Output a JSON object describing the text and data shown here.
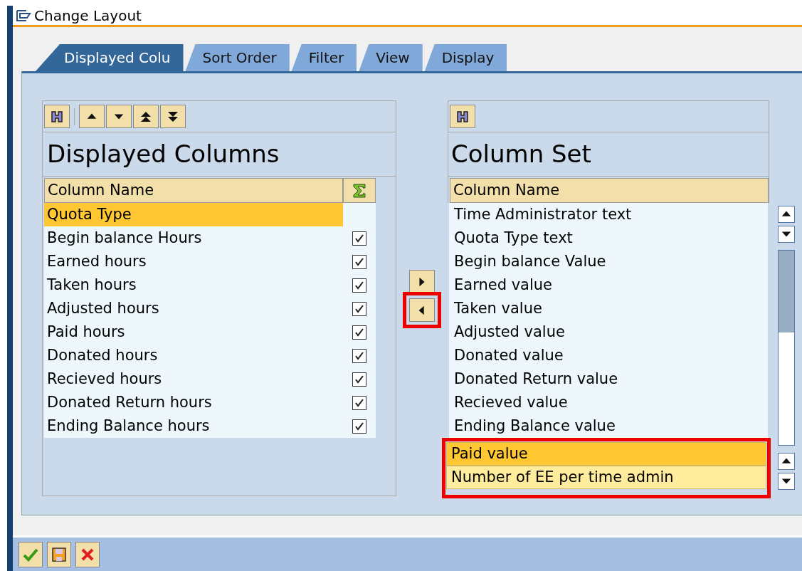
{
  "window": {
    "title": "Change Layout"
  },
  "tabs": [
    {
      "label": "Displayed Colu",
      "selected": true
    },
    {
      "label": "Sort Order",
      "selected": false
    },
    {
      "label": "Filter",
      "selected": false
    },
    {
      "label": "View",
      "selected": false
    },
    {
      "label": "Display",
      "selected": false
    }
  ],
  "displayed_columns": {
    "title": "Displayed Columns",
    "header": "Column Name",
    "items": [
      {
        "name": "Quota Type",
        "selected": true,
        "checked": false
      },
      {
        "name": "Begin balance Hours",
        "selected": false,
        "checked": true
      },
      {
        "name": "Earned hours",
        "selected": false,
        "checked": true
      },
      {
        "name": "Taken hours",
        "selected": false,
        "checked": true
      },
      {
        "name": "Adjusted hours",
        "selected": false,
        "checked": true
      },
      {
        "name": "Paid hours",
        "selected": false,
        "checked": true
      },
      {
        "name": "Donated hours",
        "selected": false,
        "checked": true
      },
      {
        "name": "Recieved hours",
        "selected": false,
        "checked": true
      },
      {
        "name": "Donated Return hours",
        "selected": false,
        "checked": true
      },
      {
        "name": "Ending Balance hours",
        "selected": false,
        "checked": true
      }
    ]
  },
  "transfer_buttons": [
    {
      "kind": "add",
      "highlighted": false
    },
    {
      "kind": "remove",
      "highlighted": true
    }
  ],
  "column_set": {
    "title": "Column Set",
    "header": "Column Name",
    "items": [
      {
        "name": "Time Administrator text",
        "selected": false,
        "current": false,
        "highlighted": false
      },
      {
        "name": "Quota Type text",
        "selected": false,
        "current": false,
        "highlighted": false
      },
      {
        "name": "Begin balance Value",
        "selected": false,
        "current": false,
        "highlighted": false
      },
      {
        "name": "Earned value",
        "selected": false,
        "current": false,
        "highlighted": false
      },
      {
        "name": "Taken value",
        "selected": false,
        "current": false,
        "highlighted": false
      },
      {
        "name": "Adjusted value",
        "selected": false,
        "current": false,
        "highlighted": false
      },
      {
        "name": "Donated value",
        "selected": false,
        "current": false,
        "highlighted": false
      },
      {
        "name": "Donated Return value",
        "selected": false,
        "current": false,
        "highlighted": false
      },
      {
        "name": "Recieved value",
        "selected": false,
        "current": false,
        "highlighted": false
      },
      {
        "name": "Ending Balance value",
        "selected": false,
        "current": false,
        "highlighted": false
      },
      {
        "name": "Paid value",
        "selected": true,
        "current": true,
        "highlighted": true
      },
      {
        "name": "Number of EE per time admin",
        "selected": true,
        "current": false,
        "highlighted": true
      }
    ]
  },
  "footer_buttons": [
    {
      "kind": "confirm"
    },
    {
      "kind": "save"
    },
    {
      "kind": "cancel"
    }
  ]
}
